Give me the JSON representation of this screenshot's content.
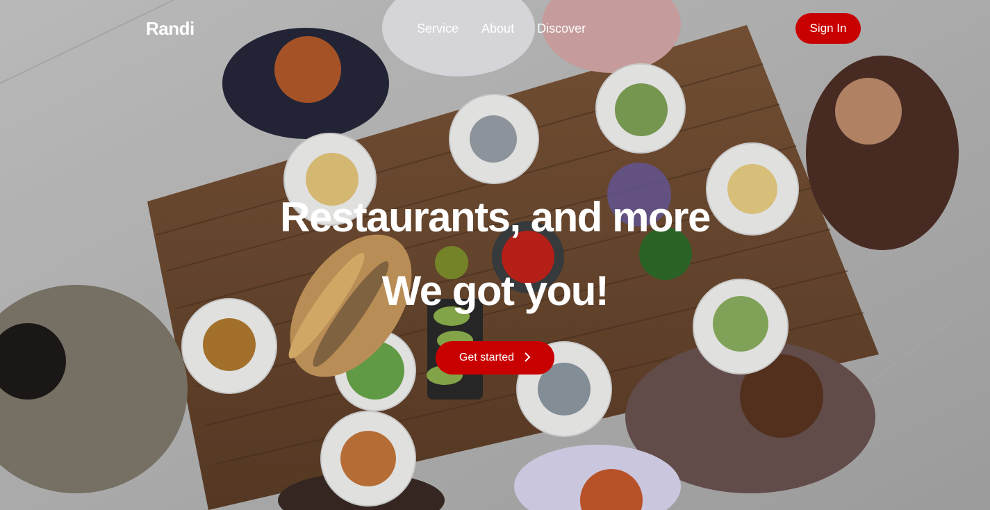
{
  "nav": {
    "logo": "Randi",
    "links": [
      "Service",
      "About",
      "Discover"
    ],
    "signin_label": "Sign In"
  },
  "hero": {
    "headline": "Restaurants, and more",
    "subheadline": "We got you!",
    "cta_label": "Get started",
    "cta_icon": "chevron-right-icon",
    "background_image": "people dining at a long wooden table with pasta plates (top view)"
  },
  "colors": {
    "accent": "#c80000",
    "text_on_image": "#ffffff"
  }
}
